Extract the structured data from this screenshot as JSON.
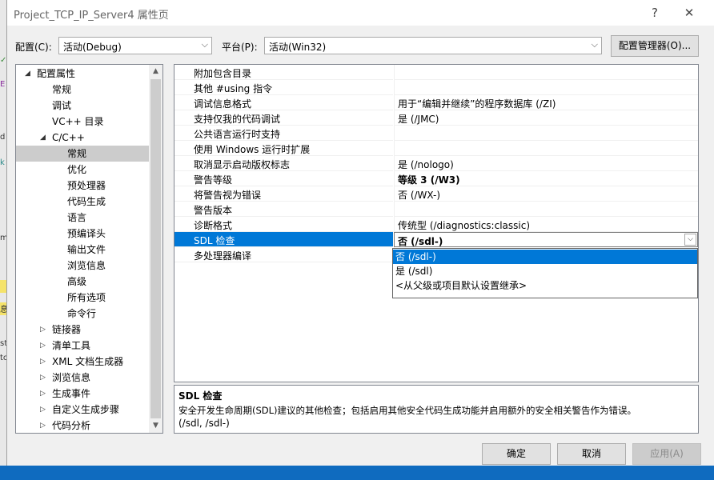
{
  "window": {
    "title": "Project_TCP_IP_Server4 属性页",
    "help_symbol": "?",
    "close_symbol": "✕"
  },
  "config": {
    "label": "配置(C):",
    "value": "活动(Debug)"
  },
  "platform": {
    "label": "平台(P):",
    "value": "活动(Win32)"
  },
  "config_manager_label": "配置管理器(O)...",
  "tree": {
    "items": [
      {
        "label": "配置属性",
        "level": 0,
        "expander": "expanded"
      },
      {
        "label": "常规",
        "level": 1
      },
      {
        "label": "调试",
        "level": 1
      },
      {
        "label": "VC++ 目录",
        "level": 1
      },
      {
        "label": "C/C++",
        "level": 1,
        "expander": "expanded"
      },
      {
        "label": "常规",
        "level": 2,
        "selected": true
      },
      {
        "label": "优化",
        "level": 2
      },
      {
        "label": "预处理器",
        "level": 2
      },
      {
        "label": "代码生成",
        "level": 2
      },
      {
        "label": "语言",
        "level": 2
      },
      {
        "label": "预编译头",
        "level": 2
      },
      {
        "label": "输出文件",
        "level": 2
      },
      {
        "label": "浏览信息",
        "level": 2
      },
      {
        "label": "高级",
        "level": 2
      },
      {
        "label": "所有选项",
        "level": 2
      },
      {
        "label": "命令行",
        "level": 2
      },
      {
        "label": "链接器",
        "level": 1,
        "expander": "collapsed"
      },
      {
        "label": "清单工具",
        "level": 1,
        "expander": "collapsed"
      },
      {
        "label": "XML 文档生成器",
        "level": 1,
        "expander": "collapsed"
      },
      {
        "label": "浏览信息",
        "level": 1,
        "expander": "collapsed"
      },
      {
        "label": "生成事件",
        "level": 1,
        "expander": "collapsed"
      },
      {
        "label": "自定义生成步骤",
        "level": 1,
        "expander": "collapsed"
      },
      {
        "label": "代码分析",
        "level": 1,
        "expander": "collapsed"
      }
    ]
  },
  "properties": [
    {
      "name": "附加包含目录",
      "value": ""
    },
    {
      "name": "其他 #using 指令",
      "value": ""
    },
    {
      "name": "调试信息格式",
      "value": "用于“编辑并继续”的程序数据库 (/ZI)"
    },
    {
      "name": "支持仅我的代码调试",
      "value": "是 (/JMC)"
    },
    {
      "name": "公共语言运行时支持",
      "value": ""
    },
    {
      "name": "使用 Windows 运行时扩展",
      "value": ""
    },
    {
      "name": "取消显示启动版权标志",
      "value": "是 (/nologo)"
    },
    {
      "name": "警告等级",
      "value": "等级 3 (/W3)",
      "bold": true
    },
    {
      "name": "将警告视为错误",
      "value": "否 (/WX-)"
    },
    {
      "name": "警告版本",
      "value": ""
    },
    {
      "name": "诊断格式",
      "value": "传统型 (/diagnostics:classic)"
    },
    {
      "name": "SDL 检查",
      "value": "否 (/sdl-)",
      "bold": true,
      "selected": true
    },
    {
      "name": "多处理器编译",
      "value": ""
    }
  ],
  "dropdown": {
    "options": [
      {
        "label": "否 (/sdl-)",
        "highlighted": true
      },
      {
        "label": "是 (/sdl)"
      },
      {
        "label": "<从父级或项目默认设置继承>"
      }
    ]
  },
  "description": {
    "title": "SDL 检查",
    "text": "安全开发生命周期(SDL)建议的其他检查；包括启用其他安全代码生成功能并启用额外的安全相关警告作为错误。",
    "switches": "(/sdl, /sdl-)"
  },
  "buttons": {
    "ok": "确定",
    "cancel": "取消",
    "apply": "应用(A)"
  },
  "colors": {
    "selection": "#0078d7",
    "tree_selection": "#cccccc",
    "dialog_bg": "#f0f0f0"
  }
}
